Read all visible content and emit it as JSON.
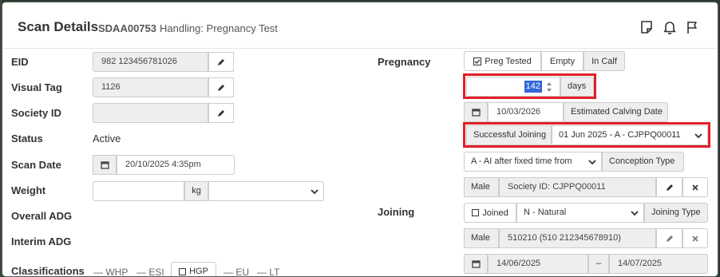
{
  "header": {
    "title": "Scan Details",
    "scan_id": "SDAA00753",
    "handling": "Handling: Pregnancy Test"
  },
  "left": {
    "eid_label": "EID",
    "eid_value": "982 123456781026",
    "visual_tag_label": "Visual Tag",
    "visual_tag_value": "1126",
    "society_id_label": "Society ID",
    "society_id_value": "",
    "status_label": "Status",
    "status_value": "Active",
    "scan_date_label": "Scan Date",
    "scan_date_value": "20/10/2025 4:35pm",
    "weight_label": "Weight",
    "weight_unit": "kg",
    "overall_adg_label": "Overall ADG",
    "interim_adg_label": "Interim ADG",
    "classifications_label": "Classifications",
    "classifications": [
      "WHP",
      "ESI",
      "HGP",
      "EU",
      "LT"
    ]
  },
  "pregnancy": {
    "label": "Pregnancy",
    "preg_tested": "Preg Tested",
    "empty": "Empty",
    "in_calf": "In Calf",
    "days_value": "142",
    "days_unit": "days",
    "calving_date": "10/03/2026",
    "calving_label": "Estimated Calving Date",
    "joining_label": "Successful Joining",
    "joining_value": "01 Jun 2025 - A - CJPPQ00011",
    "conception_value": "A - AI after fixed time from",
    "conception_label": "Conception Type",
    "sire_sex": "Male",
    "sire_society": "Society ID: CJPPQ00011"
  },
  "joining": {
    "label": "Joining",
    "joined": "Joined",
    "type_value": "N - Natural",
    "type_label": "Joining Type",
    "sire_sex": "Male",
    "sire_value": "510210 (510 212345678910)",
    "date_from": "14/06/2025",
    "date_sep": "–",
    "date_to": "14/07/2025"
  },
  "colors": {
    "highlight": "#e21f26",
    "selection": "#3367d6"
  }
}
